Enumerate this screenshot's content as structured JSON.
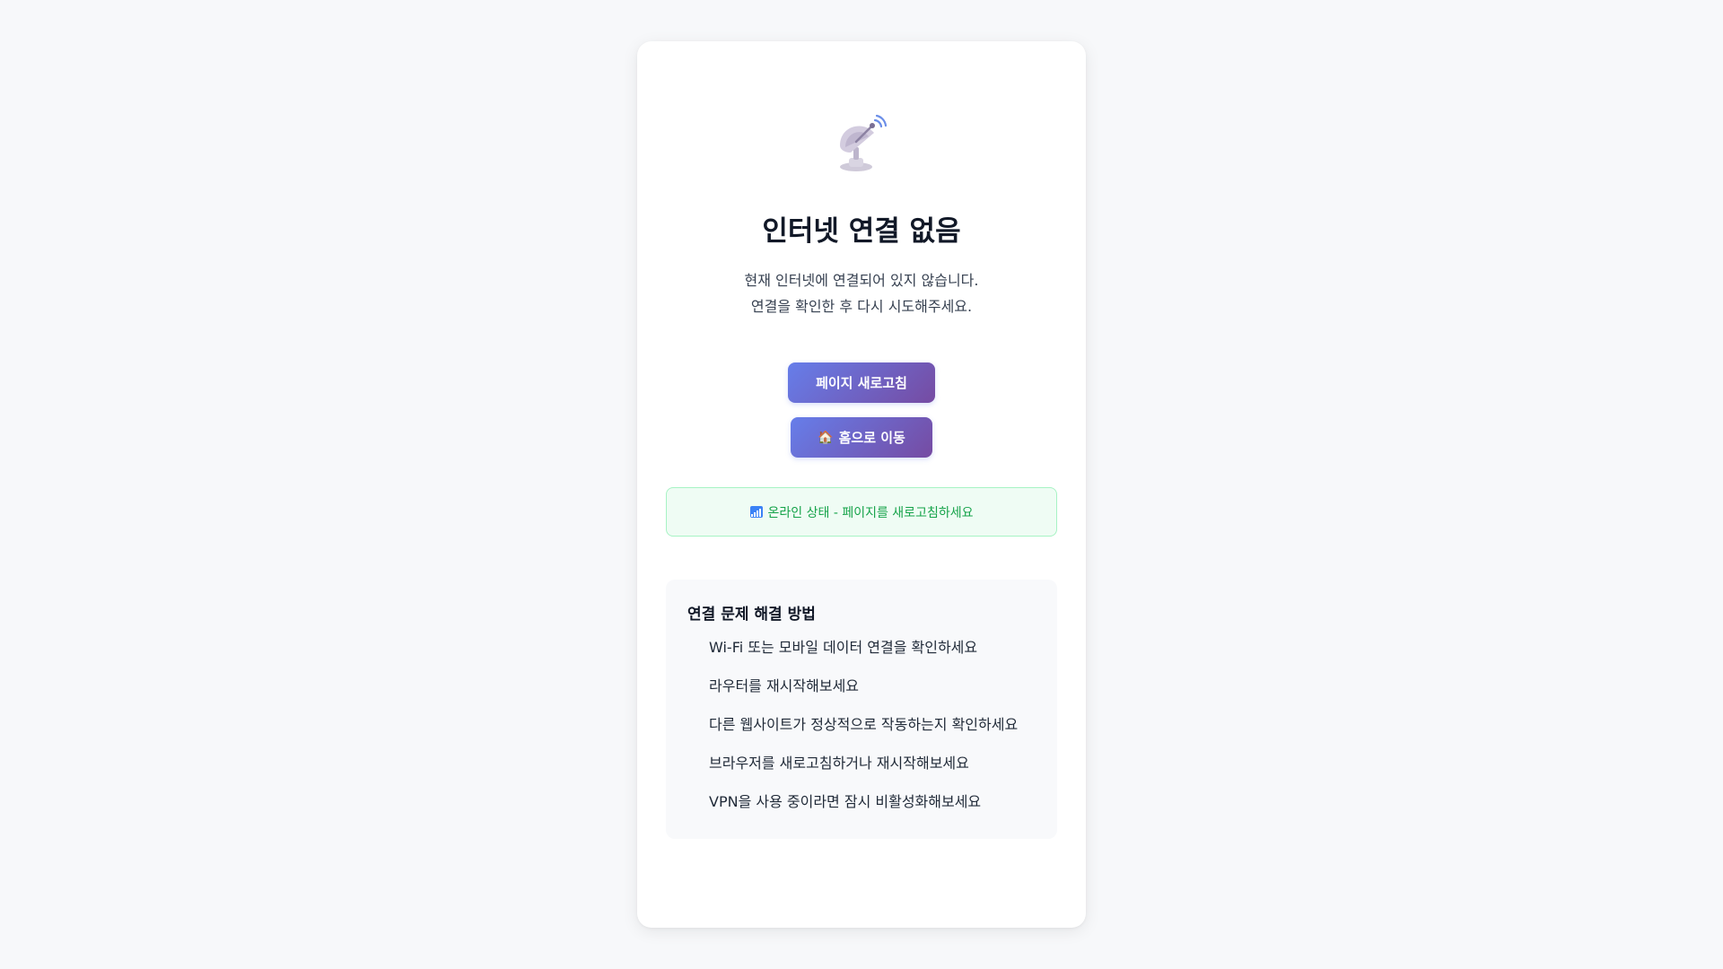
{
  "offline": {
    "icon": "satellite-dish-icon",
    "title": "인터넷 연결 없음",
    "description_lines": [
      "현재 인터넷에 연결되어 있지 않습니다.",
      "연결을 확인한 후 다시 시도해주세요."
    ],
    "refresh_button": "페이지 새로고침",
    "home_button": {
      "icon": "house-icon",
      "label": "홈으로 이동"
    },
    "status": {
      "icon": "signal-bars-icon",
      "text": "온라인 상태 - 페이지를 새로고침하세요"
    },
    "tips": {
      "title": "연결 문제 해결 방법",
      "items": [
        "Wi-Fi 또는 모바일 데이터 연결을 확인하세요",
        "라우터를 재시작해보세요",
        "다른 웹사이트가 정상적으로 작동하는지 확인하세요",
        "브라우저를 새로고침하거나 재시작해보세요",
        "VPN을 사용 중이라면 잠시 비활성화해보세요"
      ]
    },
    "colors": {
      "accent_start": "#667eea",
      "accent_end": "#764ba2",
      "status_green": "#16a34a"
    }
  }
}
